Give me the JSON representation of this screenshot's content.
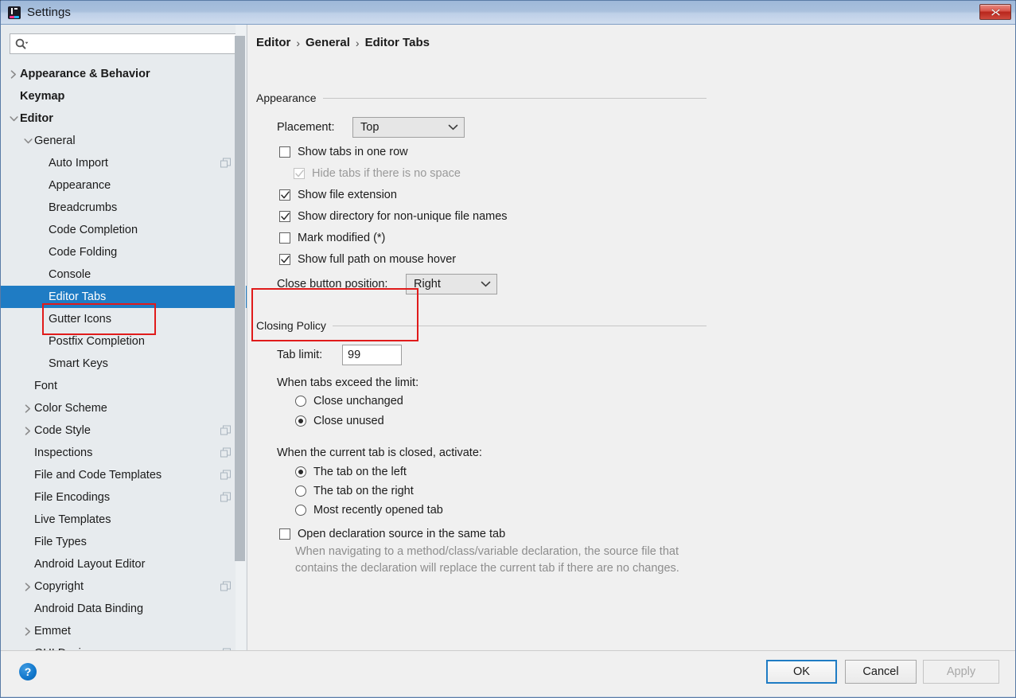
{
  "window": {
    "title": "Settings",
    "icon": "intellij-idea-icon",
    "close_label": "close-icon"
  },
  "sidebar": {
    "search": {
      "placeholder": "",
      "value": "",
      "icon": "search-icon"
    },
    "items": [
      {
        "label": "Appearance & Behavior",
        "indent": 0,
        "arrow": "right",
        "bold": true,
        "selected": false,
        "copy": false
      },
      {
        "label": "Keymap",
        "indent": 0,
        "arrow": "none",
        "bold": true,
        "selected": false,
        "copy": false
      },
      {
        "label": "Editor",
        "indent": 0,
        "arrow": "down",
        "bold": true,
        "selected": false,
        "copy": false
      },
      {
        "label": "General",
        "indent": 1,
        "arrow": "down",
        "bold": false,
        "selected": false,
        "copy": false
      },
      {
        "label": "Auto Import",
        "indent": 2,
        "arrow": "none",
        "bold": false,
        "selected": false,
        "copy": true
      },
      {
        "label": "Appearance",
        "indent": 2,
        "arrow": "none",
        "bold": false,
        "selected": false,
        "copy": false
      },
      {
        "label": "Breadcrumbs",
        "indent": 2,
        "arrow": "none",
        "bold": false,
        "selected": false,
        "copy": false
      },
      {
        "label": "Code Completion",
        "indent": 2,
        "arrow": "none",
        "bold": false,
        "selected": false,
        "copy": false
      },
      {
        "label": "Code Folding",
        "indent": 2,
        "arrow": "none",
        "bold": false,
        "selected": false,
        "copy": false
      },
      {
        "label": "Console",
        "indent": 2,
        "arrow": "none",
        "bold": false,
        "selected": false,
        "copy": false
      },
      {
        "label": "Editor Tabs",
        "indent": 2,
        "arrow": "none",
        "bold": false,
        "selected": true,
        "copy": false
      },
      {
        "label": "Gutter Icons",
        "indent": 2,
        "arrow": "none",
        "bold": false,
        "selected": false,
        "copy": false
      },
      {
        "label": "Postfix Completion",
        "indent": 2,
        "arrow": "none",
        "bold": false,
        "selected": false,
        "copy": false
      },
      {
        "label": "Smart Keys",
        "indent": 2,
        "arrow": "none",
        "bold": false,
        "selected": false,
        "copy": false
      },
      {
        "label": "Font",
        "indent": 1,
        "arrow": "none",
        "bold": false,
        "selected": false,
        "copy": false
      },
      {
        "label": "Color Scheme",
        "indent": 1,
        "arrow": "right",
        "bold": false,
        "selected": false,
        "copy": false
      },
      {
        "label": "Code Style",
        "indent": 1,
        "arrow": "right",
        "bold": false,
        "selected": false,
        "copy": true
      },
      {
        "label": "Inspections",
        "indent": 1,
        "arrow": "none",
        "bold": false,
        "selected": false,
        "copy": true
      },
      {
        "label": "File and Code Templates",
        "indent": 1,
        "arrow": "none",
        "bold": false,
        "selected": false,
        "copy": true
      },
      {
        "label": "File Encodings",
        "indent": 1,
        "arrow": "none",
        "bold": false,
        "selected": false,
        "copy": true
      },
      {
        "label": "Live Templates",
        "indent": 1,
        "arrow": "none",
        "bold": false,
        "selected": false,
        "copy": false
      },
      {
        "label": "File Types",
        "indent": 1,
        "arrow": "none",
        "bold": false,
        "selected": false,
        "copy": false
      },
      {
        "label": "Android Layout Editor",
        "indent": 1,
        "arrow": "none",
        "bold": false,
        "selected": false,
        "copy": false
      },
      {
        "label": "Copyright",
        "indent": 1,
        "arrow": "right",
        "bold": false,
        "selected": false,
        "copy": true
      },
      {
        "label": "Android Data Binding",
        "indent": 1,
        "arrow": "none",
        "bold": false,
        "selected": false,
        "copy": false
      },
      {
        "label": "Emmet",
        "indent": 1,
        "arrow": "right",
        "bold": false,
        "selected": false,
        "copy": false
      },
      {
        "label": "GUI Designer",
        "indent": 1,
        "arrow": "none",
        "bold": false,
        "selected": false,
        "copy": true
      }
    ]
  },
  "main": {
    "breadcrumb": [
      "Editor",
      "General",
      "Editor Tabs"
    ],
    "breadcrumb_separator": "›",
    "appearance": {
      "group_title": "Appearance",
      "placement_label": "Placement:",
      "placement_value": "Top",
      "checkboxes": [
        {
          "label": "Show tabs in one row",
          "checked": false,
          "disabled": false
        },
        {
          "label": "Hide tabs if there is no space",
          "checked": true,
          "disabled": true
        },
        {
          "label": "Show file extension",
          "checked": true,
          "disabled": false
        },
        {
          "label": "Show directory for non-unique file names",
          "checked": true,
          "disabled": false
        },
        {
          "label": "Mark modified (*)",
          "checked": false,
          "disabled": false
        },
        {
          "label": "Show full path on mouse hover",
          "checked": true,
          "disabled": false
        }
      ],
      "close_position_label": "Close button position:",
      "close_position_value": "Right"
    },
    "closing_policy": {
      "group_title": "Closing Policy",
      "tab_limit_label": "Tab limit:",
      "tab_limit_value": "99",
      "exceed_label": "When tabs exceed the limit:",
      "exceed_options": [
        {
          "label": "Close unchanged",
          "selected": false
        },
        {
          "label": "Close unused",
          "selected": true
        }
      ],
      "activate_label": "When the current tab is closed, activate:",
      "activate_options": [
        {
          "label": "The tab on the left",
          "selected": true
        },
        {
          "label": "The tab on the right",
          "selected": false
        },
        {
          "label": "Most recently opened tab",
          "selected": false
        }
      ],
      "open_declaration": {
        "label": "Open declaration source in the same tab",
        "checked": false
      },
      "open_declaration_desc": "When navigating to a method/class/variable declaration, the source file that contains the declaration will replace the current tab if there are no changes."
    }
  },
  "footer": {
    "help_label": "?",
    "ok_label": "OK",
    "cancel_label": "Cancel",
    "apply_label": "Apply"
  },
  "annotations": {
    "highlight_color": "#e01b1b",
    "boxes": [
      {
        "name": "editor-tabs-highlight"
      },
      {
        "name": "closing-policy-highlight"
      }
    ]
  },
  "colors": {
    "accent_selected": "#1f7cc4",
    "titlebar": "#a9c0dd",
    "panel_bg": "#f0f0f0",
    "sidebar_bg": "#e7ebee"
  }
}
